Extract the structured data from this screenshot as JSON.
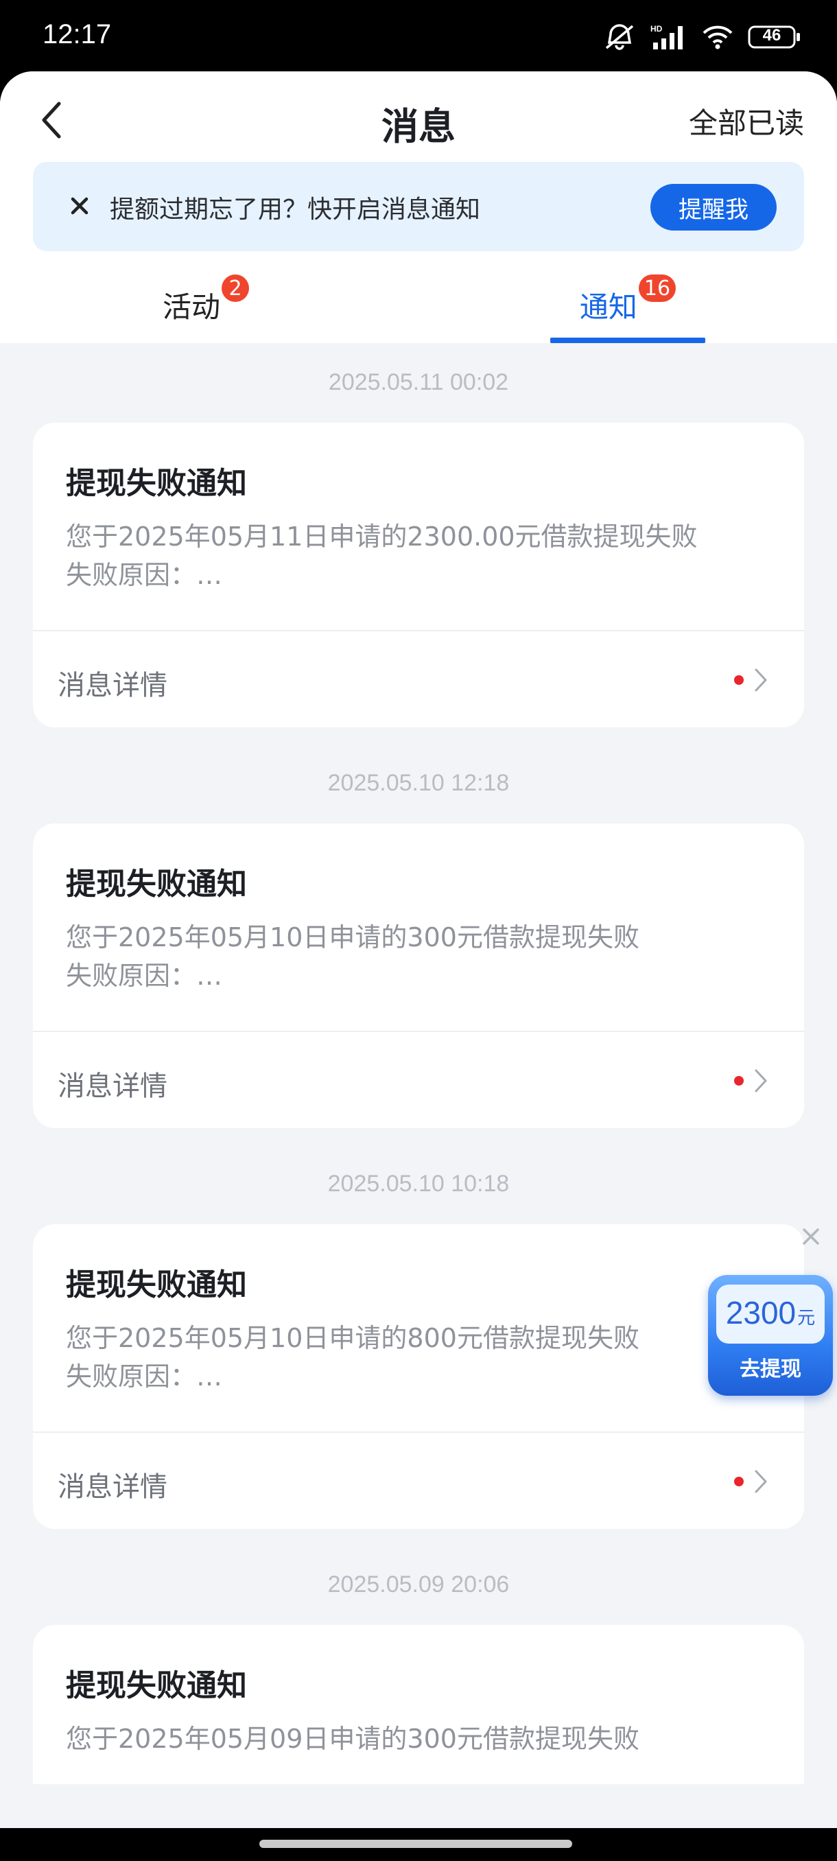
{
  "status_bar": {
    "time": "12:17",
    "battery": "46",
    "icons": [
      "mute-icon",
      "hd-signal-icon",
      "wifi-icon",
      "battery-icon"
    ]
  },
  "header": {
    "title": "消息",
    "mark_all_read": "全部已读"
  },
  "banner": {
    "text": "提额过期忘了用？快开启消息通知",
    "button": "提醒我"
  },
  "tabs": [
    {
      "label": "活动",
      "badge": "2",
      "active": false
    },
    {
      "label": "通知",
      "badge": "16",
      "active": true
    }
  ],
  "messages": [
    {
      "timestamp": "2025.05.11 00:02",
      "title": "提现失败通知",
      "line1": "您于2025年05月11日申请的2300.00元借款提现失败",
      "line2": "失败原因：…",
      "detail": "消息详情"
    },
    {
      "timestamp": "2025.05.10 12:18",
      "title": "提现失败通知",
      "line1": "您于2025年05月10日申请的300元借款提现失败",
      "line2": "失败原因：…",
      "detail": "消息详情"
    },
    {
      "timestamp": "2025.05.10 10:18",
      "title": "提现失败通知",
      "line1": "您于2025年05月10日申请的800元借款提现失败",
      "line2": "失败原因：…",
      "detail": "消息详情"
    },
    {
      "timestamp": "2025.05.09 20:06",
      "title": "提现失败通知",
      "line1": "您于2025年05月09日申请的300元借款提现失败",
      "line2": "",
      "detail": ""
    }
  ],
  "float_widget": {
    "amount": "2300",
    "unit": "元",
    "action": "去提现"
  },
  "colors": {
    "accent": "#1667e8",
    "badge": "#f0452d",
    "unread_dot": "#e8262c",
    "background": "#f2f4f7"
  }
}
